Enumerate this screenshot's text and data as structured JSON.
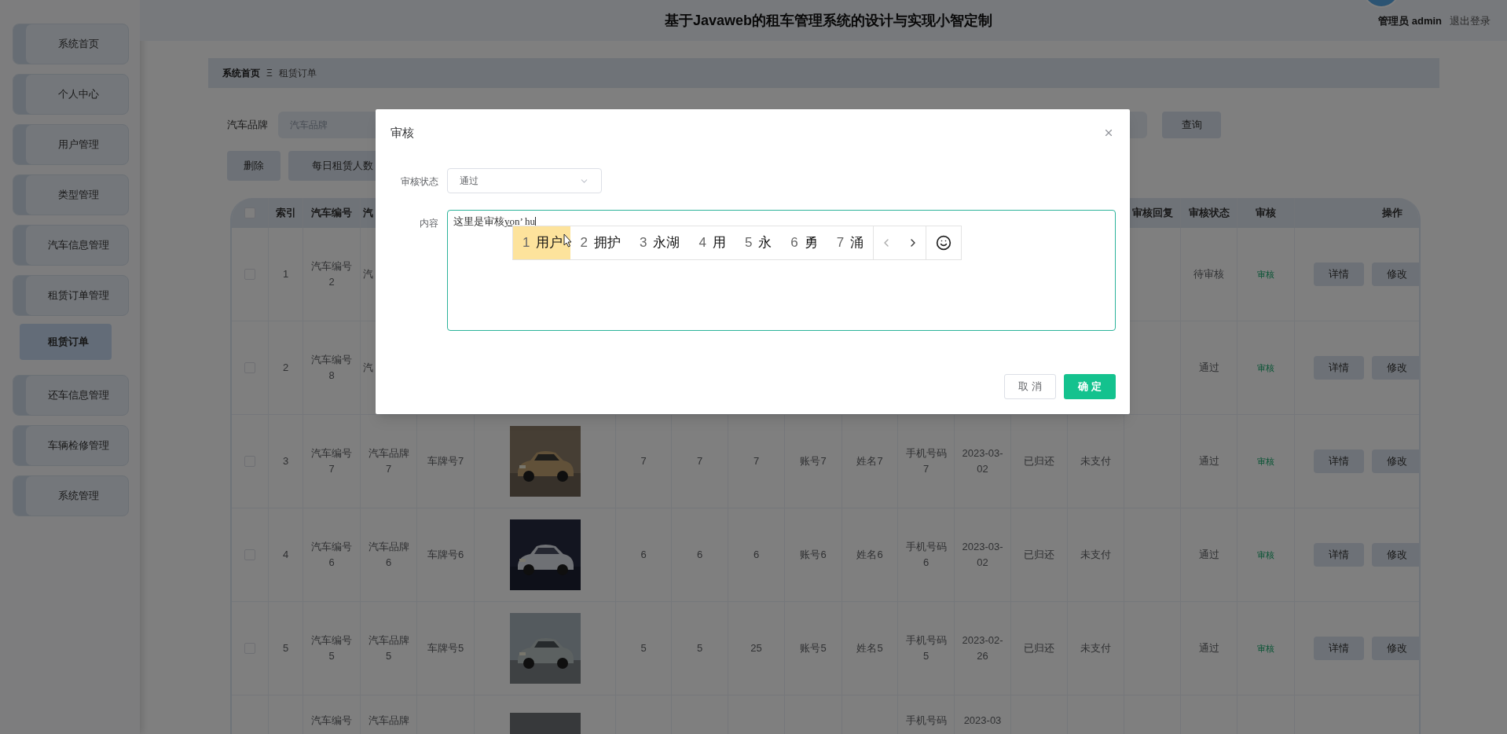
{
  "header": {
    "title": "基于Javaweb的租车管理系统的设计与实现小智定制",
    "user": "管理员 admin",
    "logout": "退出登录"
  },
  "sidebar": {
    "items": [
      {
        "label": "系统首页",
        "selected": false
      },
      {
        "label": "个人中心",
        "selected": false
      },
      {
        "label": "用户管理",
        "selected": false
      },
      {
        "label": "类型管理",
        "selected": false
      },
      {
        "label": "汽车信息管理",
        "selected": false
      },
      {
        "label": "租赁订单管理",
        "selected": false,
        "children": [
          {
            "label": "租赁订单",
            "selected": true
          }
        ]
      },
      {
        "label": "还车信息管理",
        "selected": false
      },
      {
        "label": "车辆检修管理",
        "selected": false
      },
      {
        "label": "系统管理",
        "selected": false
      }
    ]
  },
  "breadcrumb": {
    "items": [
      "系统首页",
      "租赁订单"
    ],
    "separator": "Ξ"
  },
  "search": {
    "label": "汽车品牌",
    "placeholder": "汽车品牌",
    "button": "查询"
  },
  "actions": [
    "删除",
    "每日租赁人数"
  ],
  "table": {
    "header_checked": false,
    "columns": {
      "index": "索引",
      "car_no": "汽车编号",
      "brand": "汽",
      "review_reply": "审核回复",
      "review_status": "审核状态",
      "review": "审核",
      "actions": "操作"
    },
    "rows": [
      {
        "kind": "covered",
        "checked": false,
        "index": "1",
        "car_no": "汽车编号2",
        "brand": "汽",
        "review_status": "待审核",
        "review": "审核",
        "actions": [
          "详情",
          "修改"
        ]
      },
      {
        "kind": "covered",
        "checked": false,
        "index": "2",
        "car_no": "汽车编号8",
        "brand": "汽",
        "review_status": "通过",
        "review": "审核",
        "actions": [
          "详情",
          "修改"
        ]
      },
      {
        "kind": "full",
        "checked": false,
        "index": "3",
        "car_no": "汽车编号7",
        "brand": "汽车品牌7",
        "plate": "车牌号7",
        "column_7": "7",
        "column_8": "7",
        "column_9": "7",
        "account": "账号7",
        "name": "姓名7",
        "phone": "手机号码7",
        "date": "2023-03-02",
        "return_status": "已归还",
        "payment_status": "未支付",
        "review_status": "通过",
        "review": "审核",
        "actions": [
          "详情",
          "修改"
        ]
      },
      {
        "kind": "full",
        "checked": false,
        "index": "4",
        "car_no": "汽车编号6",
        "brand": "汽车品牌6",
        "plate": "车牌号6",
        "column_7": "6",
        "column_8": "6",
        "column_9": "6",
        "account": "账号6",
        "name": "姓名6",
        "phone": "手机号码6",
        "date": "2023-03-02",
        "return_status": "已归还",
        "payment_status": "未支付",
        "review_status": "通过",
        "review": "审核",
        "actions": [
          "详情",
          "修改"
        ]
      },
      {
        "kind": "full",
        "checked": false,
        "index": "5",
        "car_no": "汽车编号5",
        "brand": "汽车品牌5",
        "plate": "车牌号5",
        "column_7": "5",
        "column_8": "5",
        "column_9": "25",
        "account": "账号5",
        "name": "姓名5",
        "phone": "手机号码5",
        "date": "2023-02-26",
        "return_status": "已归还",
        "payment_status": "未支付",
        "review_status": "通过",
        "review": "审核",
        "actions": [
          "详情",
          "修改"
        ]
      },
      {
        "kind": "cut",
        "car_no": "汽车编号",
        "brand": "汽车品牌",
        "phone": "手机号码",
        "date": "2023-03"
      }
    ]
  },
  "dialog": {
    "title": "审核",
    "fields": [
      {
        "kind": "select",
        "label": "审核状态",
        "value": "通过"
      },
      {
        "kind": "textarea",
        "label": "内容",
        "value": "这里是审核",
        "composition": "yon’ hu"
      }
    ],
    "ime": {
      "candidates": [
        {
          "number": "1",
          "text": "用户",
          "selected": true
        },
        {
          "number": "2",
          "text": "拥护",
          "selected": false
        },
        {
          "number": "3",
          "text": "永湖",
          "selected": false
        },
        {
          "number": "4",
          "text": "用",
          "selected": false
        },
        {
          "number": "5",
          "text": "永",
          "selected": false
        },
        {
          "number": "6",
          "text": "勇",
          "selected": false
        },
        {
          "number": "7",
          "text": "涌",
          "selected": false
        }
      ]
    },
    "buttons": [
      {
        "kind": "default",
        "label": "取 消"
      },
      {
        "kind": "primary",
        "label": "确 定"
      }
    ]
  }
}
